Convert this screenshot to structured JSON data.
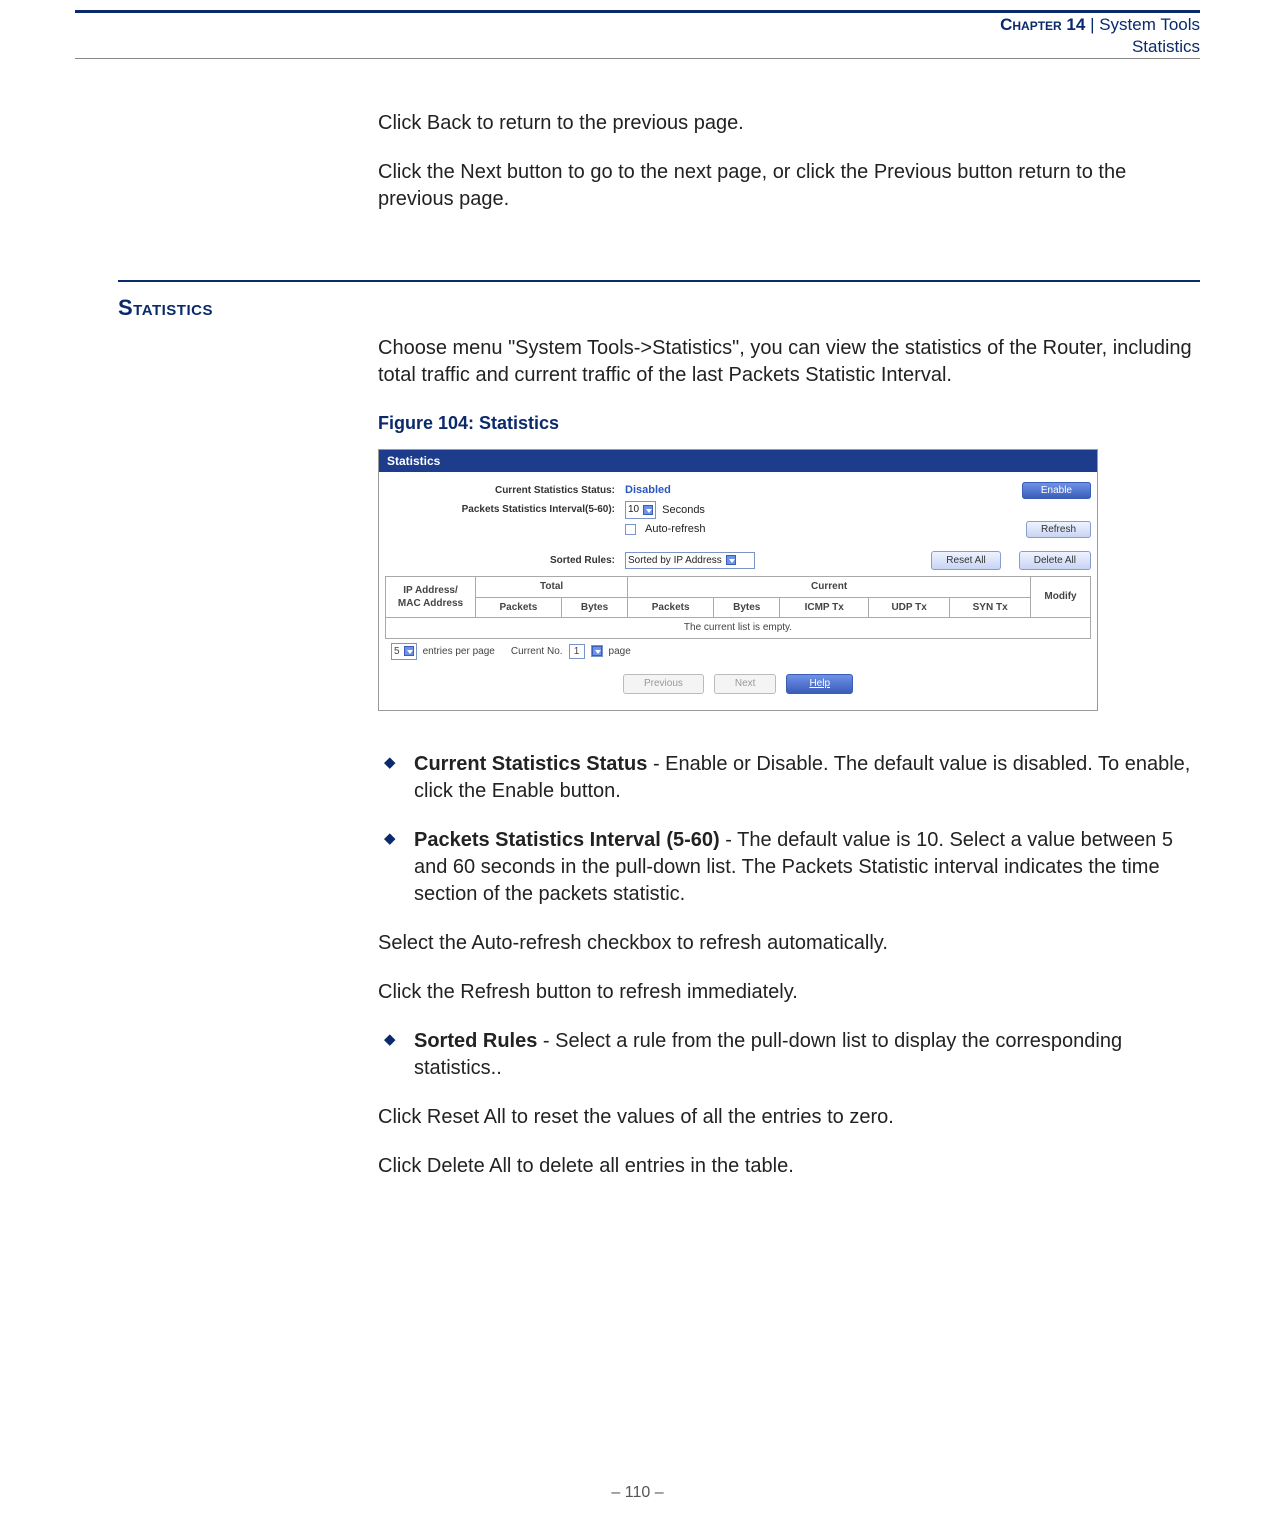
{
  "header": {
    "chapter_label": "Chapter 14",
    "separator": "  |  ",
    "line1_right": "System Tools",
    "line2": "Statistics"
  },
  "intro": {
    "p1": "Click Back to return to the previous page.",
    "p2": "Click the Next button to go to the next page, or click the Previous button return to the previous page."
  },
  "section": {
    "heading": "Statistics",
    "p1": "Choose menu \"System Tools->Statistics\", you can view the statistics of the Router, including total traffic and current traffic of the last Packets Statistic Interval.",
    "figure_label": "Figure 104:  Statistics",
    "figure": {
      "title": "Statistics",
      "row_status_label": "Current Statistics Status:",
      "row_status_value": "Disabled",
      "btn_enable": "Enable",
      "row_interval_label": "Packets Statistics Interval(5-60):",
      "row_interval_value": "10",
      "row_interval_unit": "Seconds",
      "auto_refresh_label": "Auto-refresh",
      "btn_refresh": "Refresh",
      "row_sorted_label": "Sorted Rules:",
      "row_sorted_value": "Sorted by IP Address",
      "btn_reset_all": "Reset All",
      "btn_delete_all": "Delete All",
      "table": {
        "col0": "IP Address/\nMAC Address",
        "grp_total": "Total",
        "grp_current": "Current",
        "col_packets": "Packets",
        "col_bytes": "Bytes",
        "col_packets2": "Packets",
        "col_bytes2": "Bytes",
        "col_icmp": "ICMP Tx",
        "col_udp": "UDP Tx",
        "col_syn": "SYN Tx",
        "col_modify": "Modify",
        "empty": "The current list is empty."
      },
      "entries_val": "5",
      "entries_label": "entries per page",
      "current_no_label": "Current No.",
      "current_no_val": "1",
      "page_label": "page",
      "btn_prev": "Previous",
      "btn_next": "Next",
      "btn_help": "Help"
    },
    "bullets": {
      "b1_bold": "Current Statistics Status",
      "b1_rest": " - Enable or Disable. The default value is disabled. To enable, click the Enable button.",
      "b2_bold": "Packets Statistics Interval (5-60)",
      "b2_rest": " - The default value is 10. Select a value between 5 and 60 seconds in the pull-down list. The Packets Statistic interval indicates the time section of the packets statistic.",
      "p3": "Select the Auto-refresh checkbox to refresh automatically.",
      "p4": "Click the Refresh button to refresh immediately.",
      "b3_bold": "Sorted Rules",
      "b3_rest": " - Select a rule from the pull-down list to display the corresponding statistics..",
      "p5": "Click Reset All to reset the values of all the entries to zero.",
      "p6": "Click Delete All to delete all entries in the table."
    }
  },
  "page_number": "–  110  –"
}
